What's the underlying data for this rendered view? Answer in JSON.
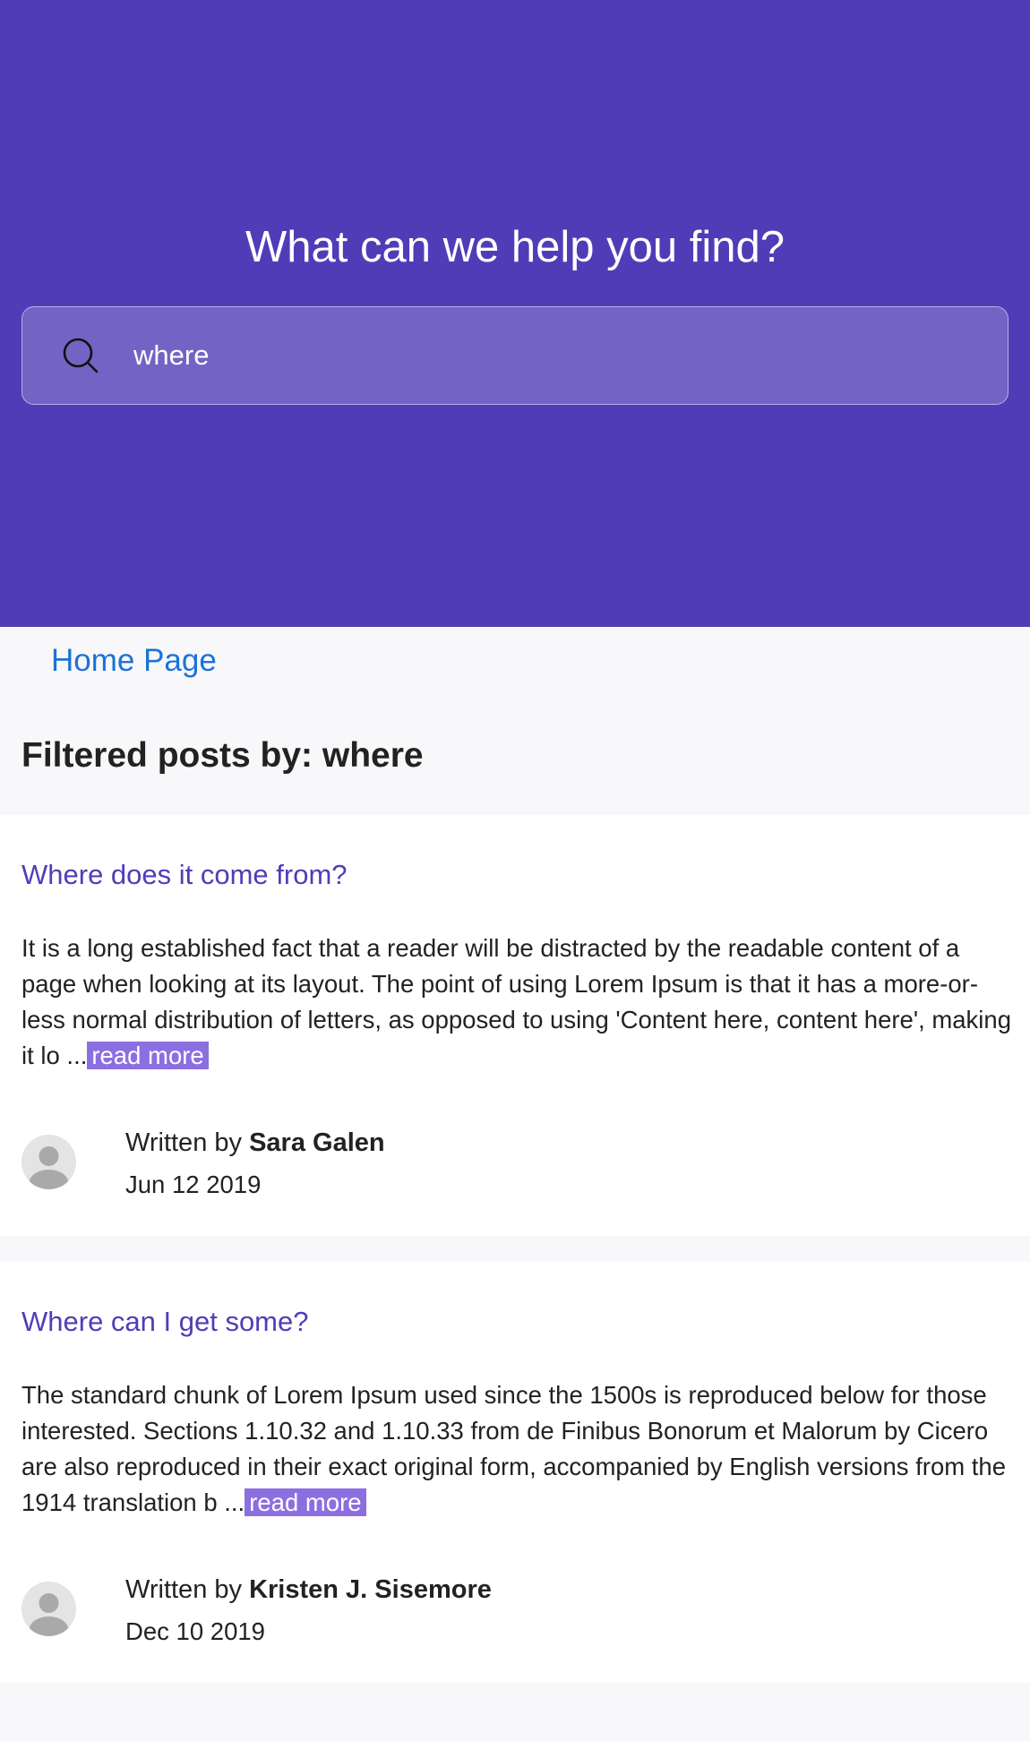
{
  "hero": {
    "title": "What can we help you find?",
    "search": {
      "value": "where",
      "icon": "search-icon"
    }
  },
  "breadcrumb": {
    "label": "Home Page"
  },
  "filter": {
    "heading": "Filtered posts by: where"
  },
  "colors": {
    "hero_bg": "#513cb8",
    "search_bg": "#7363c4",
    "link_blue": "#1a73d8",
    "post_title": "#513cb8",
    "read_more_bg": "#8b6fe0"
  },
  "posts": [
    {
      "title": "Where does it come from?",
      "excerpt": "It is a long established fact that a reader will be distracted by the readable content of a page when looking at its layout. The point of using Lorem Ipsum is that it has a more-or-less normal distribution of letters, as opposed to using 'Content here, content here', making it lo ...",
      "read_more": "read more",
      "written_by": "Written by",
      "author": "Sara Galen",
      "date": "Jun 12 2019",
      "avatar_icon": "user-avatar-icon"
    },
    {
      "title": "Where can I get some?",
      "excerpt": "The standard chunk of Lorem Ipsum used since the 1500s is reproduced below for those interested. Sections 1.10.32 and 1.10.33 from de Finibus Bonorum et Malorum by Cicero are also reproduced in their exact original form, accompanied by English versions from the 1914 translation b ...",
      "read_more": "read more",
      "written_by": "Written by",
      "author": "Kristen J. Sisemore",
      "date": "Dec 10 2019",
      "avatar_icon": "user-avatar-icon"
    }
  ]
}
